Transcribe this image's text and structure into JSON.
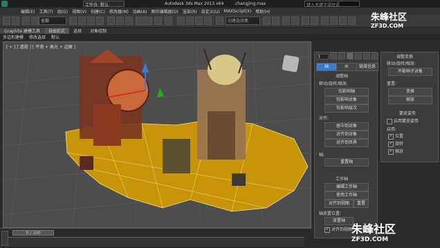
{
  "titlebar": {
    "app_title": "Autodesk 3ds Max  2013 x64",
    "file": "changjing.max",
    "search_placeholder": "键入关键字或短语"
  },
  "menubar": {
    "items": [
      "编辑(E)",
      "工具(T)",
      "组(G)",
      "视图(V)",
      "创建(C)",
      "修改器(M)",
      "动画(A)",
      "图形编辑器(D)",
      "渲染(R)",
      "自定义(U)",
      "MAXScript(X)",
      "帮助(H)"
    ],
    "workspace": "工作台: 默认"
  },
  "toolbar": {
    "selection_filter": "全部",
    "named_selection": "创建选择集"
  },
  "ribbon": {
    "tabs": [
      "Graphite 建模工具",
      "自由形式",
      "选择",
      "对象绘制"
    ]
  },
  "subribbon": {
    "items": [
      "多边形建模",
      "修改选择",
      "默认"
    ]
  },
  "viewport": {
    "label": "[ + ] [ 透视 ] [ 平滑 + 高光 + 边面 ]"
  },
  "hierarchy_panel": {
    "object_name": "3",
    "tabs": [
      "轴",
      "IK",
      "链接信息"
    ],
    "section_adjust_pivot": "调整轴",
    "move_rotate_label": "移动/旋转/缩放:",
    "btn_affect_pivot": "仅影响轴",
    "btn_affect_object": "仅影响对象",
    "btn_affect_hierarchy": "仅影响层次",
    "align_label": "对齐:",
    "btn_center_to_object": "居中到对象",
    "btn_align_to_object": "对齐到对象",
    "btn_align_to_world": "对齐到世界",
    "pivot_label": "轴:",
    "btn_reset_pivot": "重置轴",
    "section_working_pivot": "工作轴",
    "btn_edit_working_pivot": "编辑工作轴",
    "btn_use_working_pivot": "使用工作轴",
    "btn_align_to_view": "对齐到视图",
    "btn_reset": "重置",
    "placement_label": "轴放置位置:",
    "btn_place_pivot": "放置轴",
    "align_to_view_check": "对齐到视图"
  },
  "transform_panel": {
    "section_adjust_transform": "调整变换",
    "move_rotate_label": "移动/旋转/缩放:",
    "btn_dont_affect_children": "不影响子对象",
    "reset_label": "重置:",
    "btn_transform": "变换",
    "btn_scale": "缩放",
    "section_skin_pose": "蒙皮姿势",
    "enable_skin_pose": "启用蒙皮姿势",
    "enabled_label": "启用:",
    "check_position": "位置",
    "check_rotation": "旋转",
    "check_scale": "缩放"
  },
  "timeline": {
    "frame": "0 / 100"
  },
  "watermark": {
    "top": "朱峰社区",
    "top_sub": "ZF3D.COM",
    "bottom": "朱峰社区",
    "bottom_sub": "ZF3D.COM"
  },
  "colors": {
    "accent": "#3a7bd5",
    "terrain": "#c8940a",
    "viewport_bg": "#4d4d4d"
  }
}
